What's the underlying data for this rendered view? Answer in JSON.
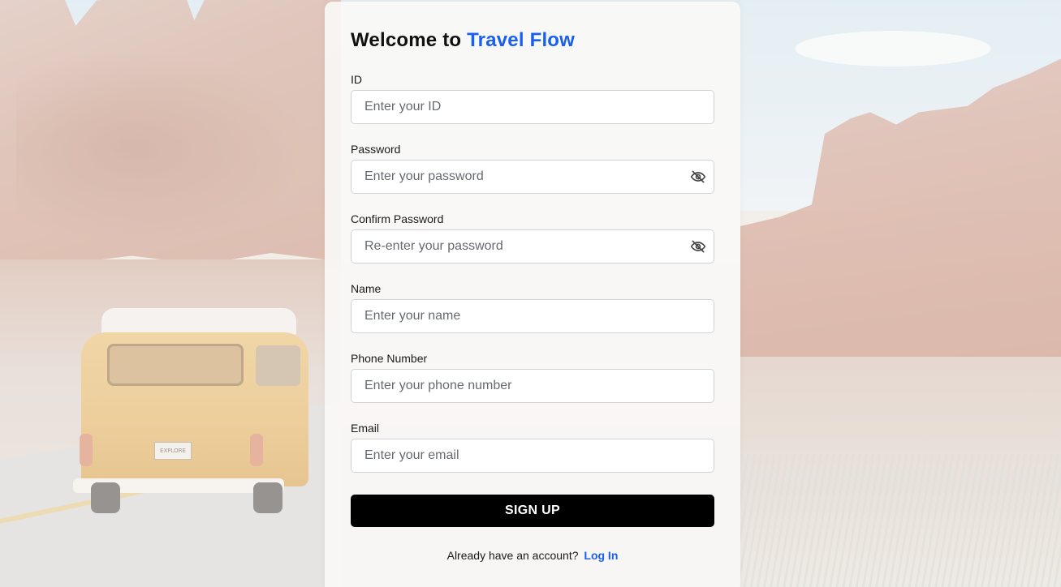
{
  "background": {
    "van_plate_text": "EXPLORE"
  },
  "form": {
    "title_prefix": "Welcome to",
    "title_brand": "Travel Flow",
    "brand_color": "#1a5ff0",
    "fields": {
      "id": {
        "label": "ID",
        "placeholder": "Enter your ID",
        "value": ""
      },
      "password": {
        "label": "Password",
        "placeholder": "Enter your password",
        "value": "",
        "toggle_icon": "eye-slash-icon"
      },
      "confirm_password": {
        "label": "Confirm Password",
        "placeholder": "Re-enter your password",
        "value": "",
        "toggle_icon": "eye-slash-icon"
      },
      "name": {
        "label": "Name",
        "placeholder": "Enter your name",
        "value": ""
      },
      "phone": {
        "label": "Phone Number",
        "placeholder": "Enter your phone number",
        "value": ""
      },
      "email": {
        "label": "Email",
        "placeholder": "Enter your email",
        "value": ""
      }
    },
    "submit_label": "SIGN UP",
    "footer_text": "Already have an account?",
    "login_link": "Log In"
  }
}
